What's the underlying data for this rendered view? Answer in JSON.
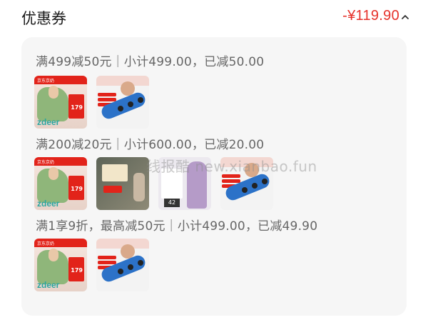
{
  "header": {
    "title": "优惠券",
    "total": "-¥119.90",
    "toggle_icon": "chevron-up-icon"
  },
  "groups": [
    {
      "rule": "满499减50元｜小计499.00，已减50.00",
      "products": [
        "product-scarf",
        "product-neck-device"
      ]
    },
    {
      "rule": "满200减20元｜小计600.00，已减20.00",
      "products": [
        "product-scarf",
        "product-massage-gun",
        "product-sports-bra",
        "product-neck-device"
      ]
    },
    {
      "rule": "满1享9折，最高减50元｜小计499.00，已减49.90",
      "products": [
        "product-scarf",
        "product-neck-device"
      ]
    }
  ],
  "thumb_text": {
    "scarf_price": "179",
    "scarf_brand": "zdeer",
    "scarf_store": "京东京奶",
    "bra_number": "42"
  },
  "watermark": "线报酷 new.xianbao.fun",
  "colors": {
    "accent_red": "#e6312a",
    "panel_bg": "#f6f6f6"
  }
}
